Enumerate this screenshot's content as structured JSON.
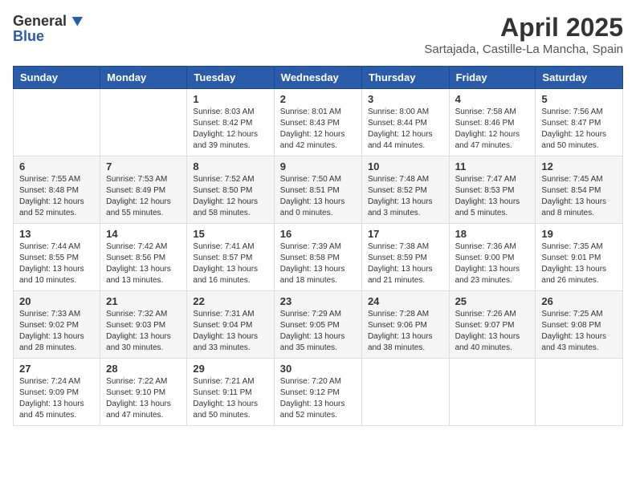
{
  "header": {
    "logo_general": "General",
    "logo_blue": "Blue",
    "month": "April 2025",
    "location": "Sartajada, Castille-La Mancha, Spain"
  },
  "days_of_week": [
    "Sunday",
    "Monday",
    "Tuesday",
    "Wednesday",
    "Thursday",
    "Friday",
    "Saturday"
  ],
  "weeks": [
    [
      {
        "day": "",
        "sunrise": "",
        "sunset": "",
        "daylight": ""
      },
      {
        "day": "",
        "sunrise": "",
        "sunset": "",
        "daylight": ""
      },
      {
        "day": "1",
        "sunrise": "Sunrise: 8:03 AM",
        "sunset": "Sunset: 8:42 PM",
        "daylight": "Daylight: 12 hours and 39 minutes."
      },
      {
        "day": "2",
        "sunrise": "Sunrise: 8:01 AM",
        "sunset": "Sunset: 8:43 PM",
        "daylight": "Daylight: 12 hours and 42 minutes."
      },
      {
        "day": "3",
        "sunrise": "Sunrise: 8:00 AM",
        "sunset": "Sunset: 8:44 PM",
        "daylight": "Daylight: 12 hours and 44 minutes."
      },
      {
        "day": "4",
        "sunrise": "Sunrise: 7:58 AM",
        "sunset": "Sunset: 8:46 PM",
        "daylight": "Daylight: 12 hours and 47 minutes."
      },
      {
        "day": "5",
        "sunrise": "Sunrise: 7:56 AM",
        "sunset": "Sunset: 8:47 PM",
        "daylight": "Daylight: 12 hours and 50 minutes."
      }
    ],
    [
      {
        "day": "6",
        "sunrise": "Sunrise: 7:55 AM",
        "sunset": "Sunset: 8:48 PM",
        "daylight": "Daylight: 12 hours and 52 minutes."
      },
      {
        "day": "7",
        "sunrise": "Sunrise: 7:53 AM",
        "sunset": "Sunset: 8:49 PM",
        "daylight": "Daylight: 12 hours and 55 minutes."
      },
      {
        "day": "8",
        "sunrise": "Sunrise: 7:52 AM",
        "sunset": "Sunset: 8:50 PM",
        "daylight": "Daylight: 12 hours and 58 minutes."
      },
      {
        "day": "9",
        "sunrise": "Sunrise: 7:50 AM",
        "sunset": "Sunset: 8:51 PM",
        "daylight": "Daylight: 13 hours and 0 minutes."
      },
      {
        "day": "10",
        "sunrise": "Sunrise: 7:48 AM",
        "sunset": "Sunset: 8:52 PM",
        "daylight": "Daylight: 13 hours and 3 minutes."
      },
      {
        "day": "11",
        "sunrise": "Sunrise: 7:47 AM",
        "sunset": "Sunset: 8:53 PM",
        "daylight": "Daylight: 13 hours and 5 minutes."
      },
      {
        "day": "12",
        "sunrise": "Sunrise: 7:45 AM",
        "sunset": "Sunset: 8:54 PM",
        "daylight": "Daylight: 13 hours and 8 minutes."
      }
    ],
    [
      {
        "day": "13",
        "sunrise": "Sunrise: 7:44 AM",
        "sunset": "Sunset: 8:55 PM",
        "daylight": "Daylight: 13 hours and 10 minutes."
      },
      {
        "day": "14",
        "sunrise": "Sunrise: 7:42 AM",
        "sunset": "Sunset: 8:56 PM",
        "daylight": "Daylight: 13 hours and 13 minutes."
      },
      {
        "day": "15",
        "sunrise": "Sunrise: 7:41 AM",
        "sunset": "Sunset: 8:57 PM",
        "daylight": "Daylight: 13 hours and 16 minutes."
      },
      {
        "day": "16",
        "sunrise": "Sunrise: 7:39 AM",
        "sunset": "Sunset: 8:58 PM",
        "daylight": "Daylight: 13 hours and 18 minutes."
      },
      {
        "day": "17",
        "sunrise": "Sunrise: 7:38 AM",
        "sunset": "Sunset: 8:59 PM",
        "daylight": "Daylight: 13 hours and 21 minutes."
      },
      {
        "day": "18",
        "sunrise": "Sunrise: 7:36 AM",
        "sunset": "Sunset: 9:00 PM",
        "daylight": "Daylight: 13 hours and 23 minutes."
      },
      {
        "day": "19",
        "sunrise": "Sunrise: 7:35 AM",
        "sunset": "Sunset: 9:01 PM",
        "daylight": "Daylight: 13 hours and 26 minutes."
      }
    ],
    [
      {
        "day": "20",
        "sunrise": "Sunrise: 7:33 AM",
        "sunset": "Sunset: 9:02 PM",
        "daylight": "Daylight: 13 hours and 28 minutes."
      },
      {
        "day": "21",
        "sunrise": "Sunrise: 7:32 AM",
        "sunset": "Sunset: 9:03 PM",
        "daylight": "Daylight: 13 hours and 30 minutes."
      },
      {
        "day": "22",
        "sunrise": "Sunrise: 7:31 AM",
        "sunset": "Sunset: 9:04 PM",
        "daylight": "Daylight: 13 hours and 33 minutes."
      },
      {
        "day": "23",
        "sunrise": "Sunrise: 7:29 AM",
        "sunset": "Sunset: 9:05 PM",
        "daylight": "Daylight: 13 hours and 35 minutes."
      },
      {
        "day": "24",
        "sunrise": "Sunrise: 7:28 AM",
        "sunset": "Sunset: 9:06 PM",
        "daylight": "Daylight: 13 hours and 38 minutes."
      },
      {
        "day": "25",
        "sunrise": "Sunrise: 7:26 AM",
        "sunset": "Sunset: 9:07 PM",
        "daylight": "Daylight: 13 hours and 40 minutes."
      },
      {
        "day": "26",
        "sunrise": "Sunrise: 7:25 AM",
        "sunset": "Sunset: 9:08 PM",
        "daylight": "Daylight: 13 hours and 43 minutes."
      }
    ],
    [
      {
        "day": "27",
        "sunrise": "Sunrise: 7:24 AM",
        "sunset": "Sunset: 9:09 PM",
        "daylight": "Daylight: 13 hours and 45 minutes."
      },
      {
        "day": "28",
        "sunrise": "Sunrise: 7:22 AM",
        "sunset": "Sunset: 9:10 PM",
        "daylight": "Daylight: 13 hours and 47 minutes."
      },
      {
        "day": "29",
        "sunrise": "Sunrise: 7:21 AM",
        "sunset": "Sunset: 9:11 PM",
        "daylight": "Daylight: 13 hours and 50 minutes."
      },
      {
        "day": "30",
        "sunrise": "Sunrise: 7:20 AM",
        "sunset": "Sunset: 9:12 PM",
        "daylight": "Daylight: 13 hours and 52 minutes."
      },
      {
        "day": "",
        "sunrise": "",
        "sunset": "",
        "daylight": ""
      },
      {
        "day": "",
        "sunrise": "",
        "sunset": "",
        "daylight": ""
      },
      {
        "day": "",
        "sunrise": "",
        "sunset": "",
        "daylight": ""
      }
    ]
  ]
}
